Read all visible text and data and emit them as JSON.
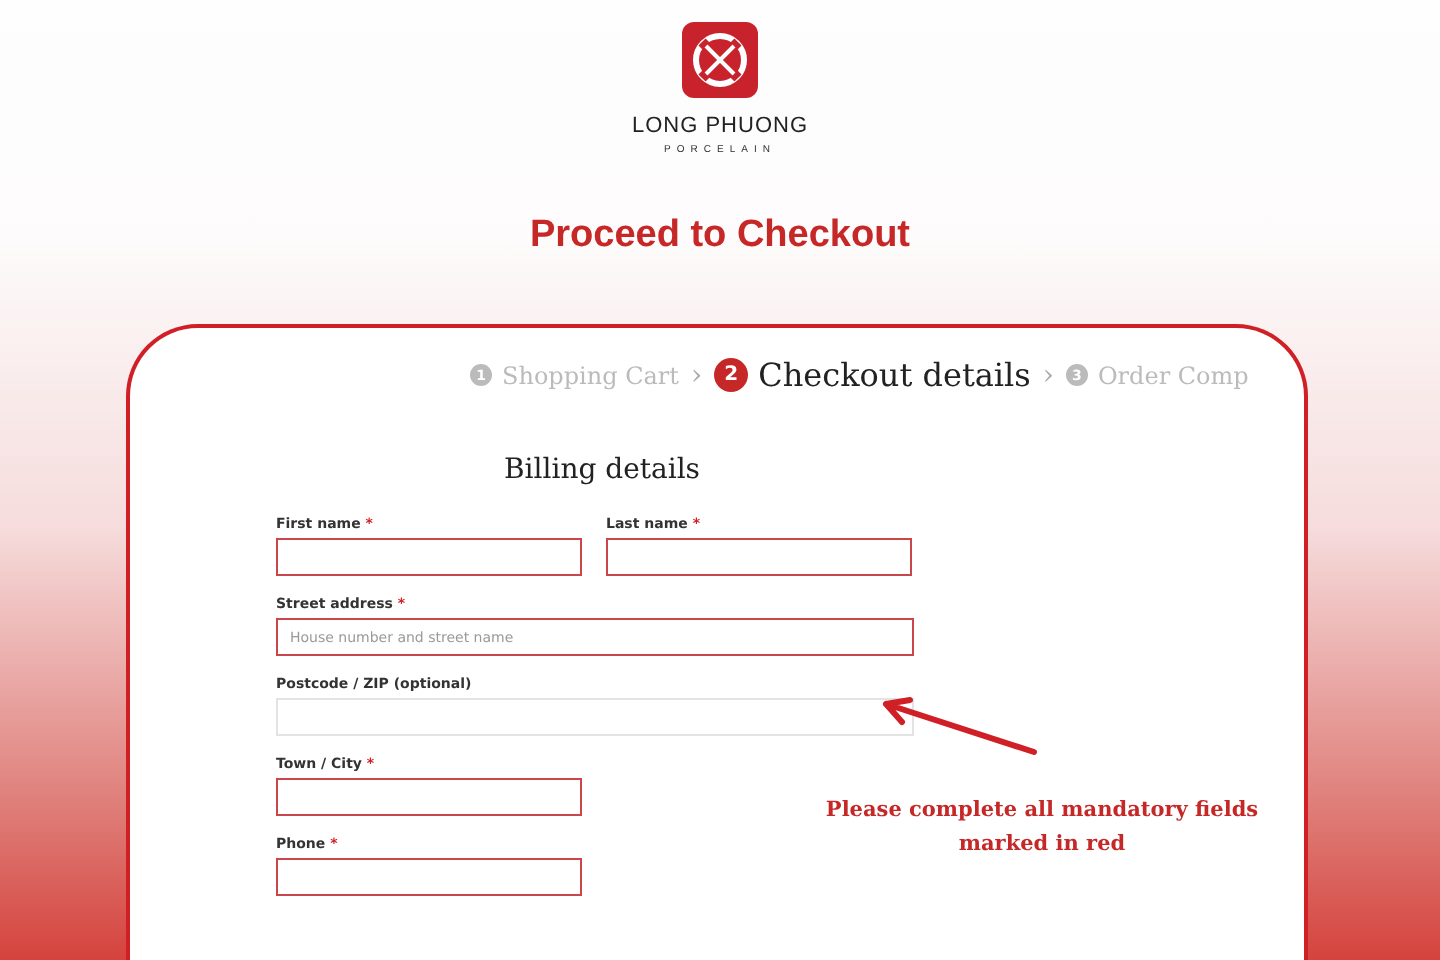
{
  "brand": {
    "name": "LONG PHUONG",
    "tagline": "PORCELAIN"
  },
  "title": "Proceed to Checkout",
  "steps": [
    {
      "number": "1",
      "label": "Shopping Cart",
      "selected": false,
      "separator": "›"
    },
    {
      "number": "2",
      "label": "Checkout details",
      "selected": true,
      "separator": "›"
    },
    {
      "number": "3",
      "label": "Order Comp",
      "selected": false
    }
  ],
  "form": {
    "heading": "Billing details",
    "rows": [
      [
        {
          "label": "First name",
          "marker": "*",
          "required": true,
          "kind": "half"
        },
        {
          "label": "Last name",
          "marker": "*",
          "required": true,
          "kind": "half"
        }
      ],
      [
        {
          "label": "Street address",
          "marker": "*",
          "required": true,
          "kind": "full",
          "placeholder": "House number and street name"
        }
      ],
      [
        {
          "label": "Postcode / ZIP (optional)",
          "required": false,
          "kind": "full"
        }
      ],
      [
        {
          "label": "Town / City",
          "marker": "*",
          "required": true,
          "kind": "half"
        }
      ],
      [
        {
          "label": "Phone",
          "marker": "*",
          "required": true,
          "kind": "half"
        }
      ]
    ]
  },
  "note": "Please complete all mandatory fields marked in red"
}
